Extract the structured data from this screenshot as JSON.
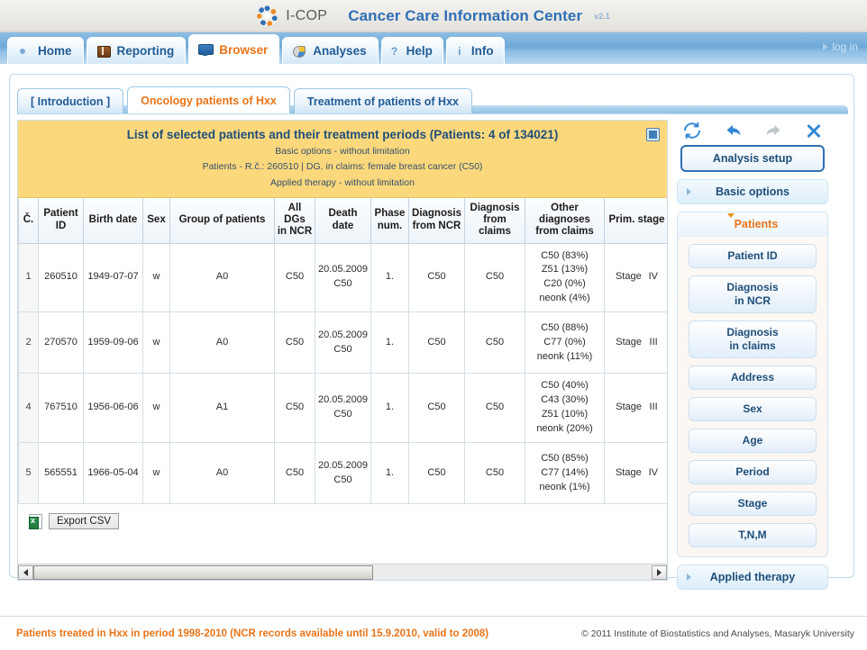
{
  "brand": {
    "logo_word": "I-COP",
    "title": "Cancer Care Information Center",
    "version": "v2.1"
  },
  "nav": {
    "login_label": "log in",
    "tabs": [
      {
        "label": "Home",
        "icon": "bullet-icon",
        "active": false
      },
      {
        "label": "Reporting",
        "icon": "book-icon",
        "active": false
      },
      {
        "label": "Browser",
        "icon": "monitor-icon",
        "active": true
      },
      {
        "label": "Analyses",
        "icon": "pie-chart-icon",
        "active": false
      },
      {
        "label": "Help",
        "icon": "question-mark-icon",
        "active": false
      },
      {
        "label": "Info",
        "icon": "info-icon",
        "active": false
      }
    ]
  },
  "subtabs": [
    {
      "label": "[ Introduction ]",
      "active": false
    },
    {
      "label": "Oncology patients of Hxx",
      "active": true
    },
    {
      "label": "Treatment of patients of Hxx",
      "active": false
    }
  ],
  "banner": {
    "title": "List of selected patients and their treatment periods (Patients: 4 of 134021)",
    "lines": [
      "Basic options - without limitation",
      "Patients - R.č.: 260510 | DG. in claims: female breast cancer (C50)",
      "Applied therapy - without limitation"
    ]
  },
  "table": {
    "columns": [
      "Č.",
      "Patient\nID",
      "Birth date",
      "Sex",
      "Group of patients",
      "All DGs\nin NCR",
      "Death date",
      "Phase\nnum.",
      "Diagnosis\nfrom NCR",
      "Diagnosis\nfrom claims",
      "Other diagnoses\nfrom claims",
      "Prim. stage"
    ],
    "rows": [
      {
        "num": "1",
        "patient_id": "260510",
        "birth_date": "1949-07-07",
        "sex": "w",
        "group": "A0",
        "all_dgs_ncr": "C50",
        "death_date": "20.05.2009\nC50",
        "phase_num": "1.",
        "dg_ncr": "C50",
        "dg_claims": "C50",
        "other_dgs": "C50 (83%)\nZ51 (13%)\nC20 (0%)\nneonk (4%)",
        "stage_label": "Stage",
        "stage_value": "IV"
      },
      {
        "num": "2",
        "patient_id": "270570",
        "birth_date": "1959-09-06",
        "sex": "w",
        "group": "A0",
        "all_dgs_ncr": "C50",
        "death_date": "20.05.2009\nC50",
        "phase_num": "1.",
        "dg_ncr": "C50",
        "dg_claims": "C50",
        "other_dgs": "C50 (88%)\nC77 (0%)\nneonk (11%)",
        "stage_label": "Stage",
        "stage_value": "III"
      },
      {
        "num": "4",
        "patient_id": "767510",
        "birth_date": "1956-06-06",
        "sex": "w",
        "group": "A1",
        "all_dgs_ncr": "C50",
        "death_date": "20.05.2009\nC50",
        "phase_num": "1.",
        "dg_ncr": "C50",
        "dg_claims": "C50",
        "other_dgs": "C50 (40%)\nC43 (30%)\nZ51 (10%)\nneonk (20%)",
        "stage_label": "Stage",
        "stage_value": "III"
      },
      {
        "num": "5",
        "patient_id": "565551",
        "birth_date": "1966-05-04",
        "sex": "w",
        "group": "A0",
        "all_dgs_ncr": "C50",
        "death_date": "20.05.2009\nC50",
        "phase_num": "1.",
        "dg_ncr": "C50",
        "dg_claims": "C50",
        "other_dgs": "C50 (85%)\nC77 (14%)\nneonk (1%)",
        "stage_label": "Stage",
        "stage_value": "IV"
      }
    ]
  },
  "export": {
    "label": "Export CSV",
    "icon": "excel-icon"
  },
  "sidebar": {
    "toolbar": [
      {
        "name": "refresh-icon",
        "state": "enabled"
      },
      {
        "name": "undo-icon",
        "state": "enabled"
      },
      {
        "name": "redo-icon",
        "state": "disabled"
      },
      {
        "name": "close-icon",
        "state": "enabled"
      }
    ],
    "setup_label": "Analysis setup",
    "basic_options_label": "Basic options",
    "patients_label": "Patients",
    "applied_therapy_label": "Applied therapy",
    "patient_buttons": [
      "Patient ID",
      "Diagnosis\nin NCR",
      "Diagnosis\nin claims",
      "Address",
      "Sex",
      "Age",
      "Period",
      "Stage",
      "T,N,M"
    ]
  },
  "footer": {
    "left": "Patients treated in Hxx in period 1998-2010 (NCR records available until 15.9.2010, valid to 2008)",
    "right": "© 2011 Institute of Biostatistics and Analyses, Masaryk University"
  },
  "colors": {
    "accent_blue": "#2f6fb5",
    "accent_orange": "#e8741a",
    "banner_yellow": "#fcd87d"
  }
}
